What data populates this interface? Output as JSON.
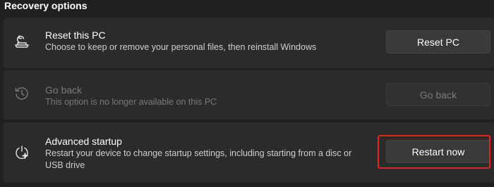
{
  "section": {
    "title": "Recovery options"
  },
  "items": [
    {
      "icon": "reset-pc-icon",
      "title": "Reset this PC",
      "description": "Choose to keep or remove your personal files, then reinstall Windows",
      "button": "Reset PC",
      "enabled": true
    },
    {
      "icon": "history-icon",
      "title": "Go back",
      "description": "This option is no longer available on this PC",
      "button": "Go back",
      "enabled": false
    },
    {
      "icon": "advanced-startup-icon",
      "title": "Advanced startup",
      "description_line1": "Restart your device to change startup settings, including starting from a disc or",
      "description_line2": "USB drive",
      "button": "Restart now",
      "enabled": true,
      "highlighted": true
    }
  ],
  "colors": {
    "background": "#202020",
    "card": "#2b2b2b",
    "button": "#3a3a3a",
    "highlight": "#e02424",
    "disabled_text": "#7a7a7a"
  }
}
